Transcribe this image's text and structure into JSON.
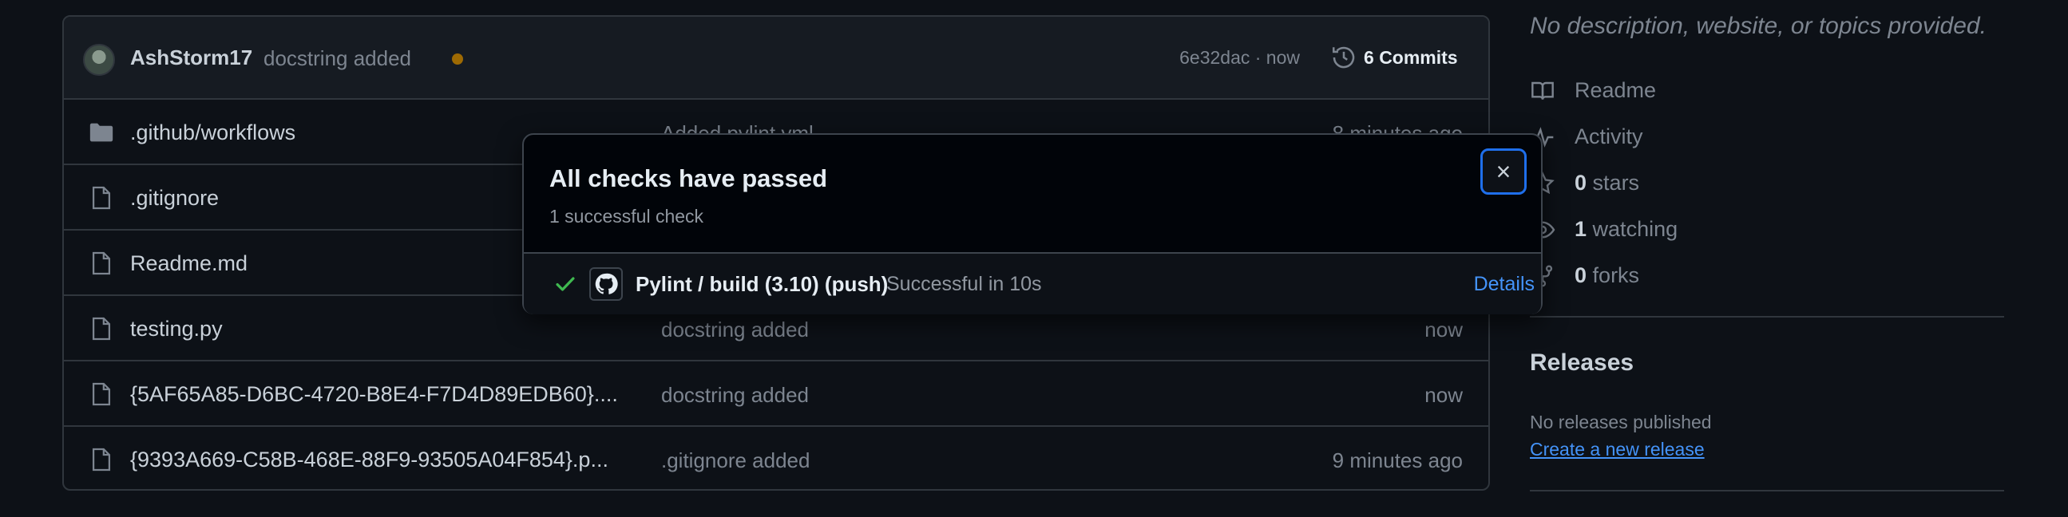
{
  "latest_commit": {
    "author": "AshStorm17",
    "message": "docstring added",
    "hash_time": "6e32dac · now",
    "commits_count": "6",
    "commits_label": "Commits",
    "status_color": "#9e6a03"
  },
  "files": [
    {
      "type": "folder",
      "icon": "folder-icon",
      "name": ".github/workflows",
      "commit": "Added pylint.yml",
      "time": "8 minutes ago"
    },
    {
      "type": "file",
      "icon": "file-icon",
      "name": ".gitignore",
      "commit": "",
      "time": ""
    },
    {
      "type": "file",
      "icon": "file-icon",
      "name": "Readme.md",
      "commit": "",
      "time": ""
    },
    {
      "type": "file",
      "icon": "file-icon",
      "name": "testing.py",
      "commit": "docstring added",
      "time": "now"
    },
    {
      "type": "file",
      "icon": "file-icon",
      "name": "{5AF65A85-D6BC-4720-B8E4-F7D4D89EDB60}....",
      "commit": "docstring added",
      "time": "now"
    },
    {
      "type": "file",
      "icon": "file-icon",
      "name": "{9393A669-C58B-468E-88F9-93505A04F854}.p...",
      "commit": ".gitignore added",
      "time": "9 minutes ago"
    }
  ],
  "sidebar": {
    "description": "No description, website, or topics provided.",
    "readme": "Readme",
    "activity": "Activity",
    "stars_count": "0",
    "stars_label": "stars",
    "watching_count": "1",
    "watching_label": "watching",
    "forks_count": "0",
    "forks_label": "forks",
    "releases_title": "Releases",
    "no_releases": "No releases published",
    "create_release": "Create a new release"
  },
  "popup": {
    "title": "All checks have passed",
    "subtitle": "1 successful check",
    "close_label": "×",
    "check_name": "Pylint / build (3.10) (push)",
    "check_status": "Successful in 10s",
    "details": "Details",
    "success_color": "#3fb950"
  }
}
